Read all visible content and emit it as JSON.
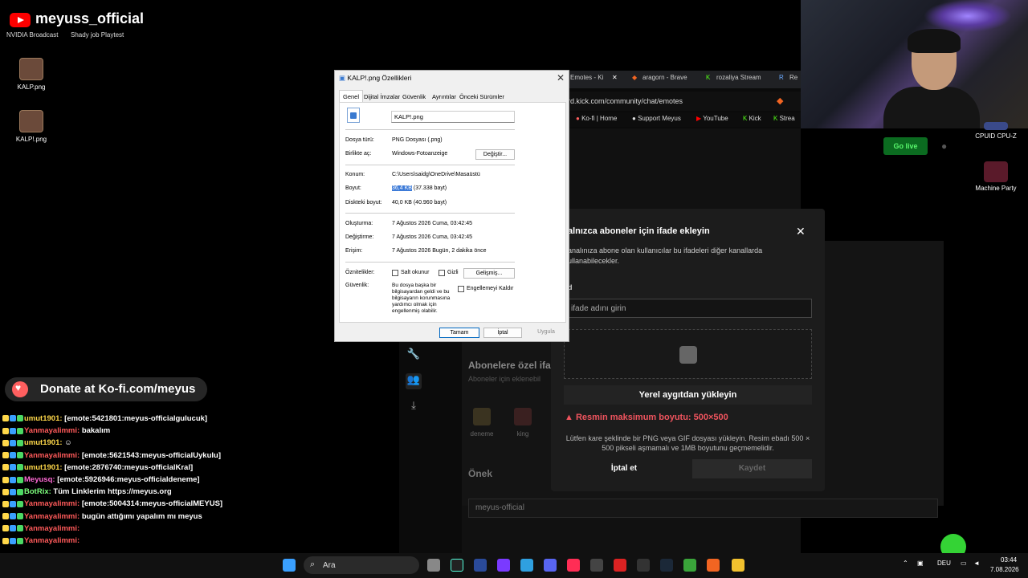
{
  "overlay": {
    "channel_name": "meyuss_official",
    "desktop_top_labels": [
      "NVIDIA Broadcast",
      "Shady job Playtest"
    ],
    "desktop_icons": [
      "KALP.png",
      "KALP!.png"
    ],
    "right_icons": [
      "CPUID CPU-Z",
      "Machine Party"
    ],
    "donate_text": "Donate at Ko-fi.com/meyus"
  },
  "browser": {
    "tabs": [
      "Emotes - Ki",
      "aragorn - Brave",
      "rozaliya Stream",
      "Re"
    ],
    "url": "rd.kick.com/community/chat/emotes",
    "bookmarks": [
      "Ko-fi | Home",
      "Support Meyus",
      "YouTube",
      "Kick",
      "Strea"
    ],
    "go_live": "Go live",
    "subscriber_section_title": "Abonelere özel ifa",
    "subscriber_section_sub": "Aboneler için eklenebil",
    "emotes": [
      "deneme",
      "king"
    ],
    "prefix_title": "Önek",
    "prefix_value": "meyus-official"
  },
  "modal": {
    "title": "alnızca aboneler için ifade ekleyin",
    "description": "analınıza abone olan kullanıcılar bu ifadeleri diğer kanallarda ullanabilecekler.",
    "name_label": "d",
    "name_placeholder": "ifade adını girin",
    "upload_button": "Yerel aygıtdan yükleyin",
    "error_text": "Resmin maksimum boyutu: 500×500",
    "help_text": "Lütfen kare şeklinde bir PNG veya GIF dosyası yükleyin. Resim ebadı 500 × 500 pikseli aşmamalı ve 1MB boyutunu geçmemelidir.",
    "cancel": "İptal et",
    "save": "Kaydet"
  },
  "dialog": {
    "title": "KALP!.png Özellikleri",
    "tabs": [
      "Genel",
      "Dijital İmzalar",
      "Güvenlik",
      "Ayrıntılar",
      "Önceki Sürümler"
    ],
    "file_name": "KALP!.png",
    "file_type_label": "Dosya türü:",
    "file_type": "PNG Dosyası (.png)",
    "opens_with_label": "Birlikte aç:",
    "opens_with": "Windows-Fotoanzeige",
    "change_button": "Değiştir...",
    "location_label": "Konum:",
    "location": "C:\\Users\\saidg\\OneDrive\\Masaüstü",
    "size_label": "Boyut:",
    "size_highlight": "36,4 KB",
    "size_rest": "(37.338 bayt)",
    "disk_size_label": "Diskteki boyut:",
    "disk_size": "40,0 KB (40.960 bayt)",
    "created_label": "Oluşturma:",
    "created": "7 Ağustos 2026 Cuma, 03:42:45",
    "modified_label": "Değiştirme:",
    "modified": "7 Ağustos 2026 Cuma, 03:42:45",
    "accessed_label": "Erişim:",
    "accessed": "7 Ağustos 2026 Bugün, 2 dakika önce",
    "attributes_label": "Öznitelikler:",
    "readonly": "Salt okunur",
    "hidden": "Gizli",
    "advanced_button": "Gelişmiş...",
    "security_label": "Güvenlik:",
    "security_text": "Bu dosya başka bir bilgisayardan geldi ve bu bilgisayarın korunmasına yardımcı olmak için engellenmiş olabilir.",
    "unblock": "Engellemeyi Kaldır",
    "ok": "Tamam",
    "cancel": "İptal",
    "apply": "Uygula"
  },
  "chat": [
    {
      "user": "umut1901:",
      "color": "#ffd84a",
      "msg": "[emote:5421801:meyus-officialgulucuk]"
    },
    {
      "user": "Yanmayalimmi:",
      "color": "#ff5a5a",
      "msg": "bakalım"
    },
    {
      "user": "umut1901:",
      "color": "#ffd84a",
      "msg": "☺"
    },
    {
      "user": "Yanmayalimmi:",
      "color": "#ff5a5a",
      "msg": "[emote:5621543:meyus-officialUykulu]"
    },
    {
      "user": "umut1901:",
      "color": "#ffd84a",
      "msg": "[emote:2876740:meyus-officialKral]"
    },
    {
      "user": "Meyusq:",
      "color": "#ff6ad5",
      "msg": "[emote:5926946:meyus-officialdeneme]"
    },
    {
      "user": "BotRix:",
      "color": "#7dff7d",
      "msg": "Tüm Linklerim https://meyus.org"
    },
    {
      "user": "Yanmayalimmi:",
      "color": "#ff5a5a",
      "msg": "[emote:5004314:meyus-officialMEYUS]"
    },
    {
      "user": "Yanmayalimmi:",
      "color": "#ff5a5a",
      "msg": "bugün attığımı yapalım mı meyus"
    },
    {
      "user": "Yanmayalimmi:",
      "color": "#ff5a5a",
      "msg": ""
    },
    {
      "user": "Yanmayalimmi:",
      "color": "#ff5a5a",
      "msg": ""
    }
  ],
  "taskbar": {
    "search_label": "Ara",
    "lang": "DEU",
    "time": "03:44",
    "date": "7.08.2026"
  }
}
